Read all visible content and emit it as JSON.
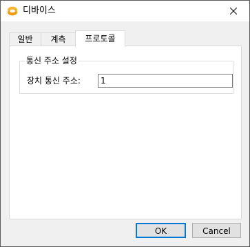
{
  "window": {
    "title": "디바이스"
  },
  "tabs": [
    {
      "label": "일반"
    },
    {
      "label": "계측"
    },
    {
      "label": "프로토콜",
      "active": true
    }
  ],
  "panel": {
    "group_title": "통신 주소 설정",
    "field_label": "장치 통신 주소:",
    "field_value": "1"
  },
  "buttons": {
    "ok_label": "OK",
    "cancel_label": "Cancel"
  },
  "colors": {
    "accent": "#0078d7",
    "icon_orange": "#f5a623"
  }
}
